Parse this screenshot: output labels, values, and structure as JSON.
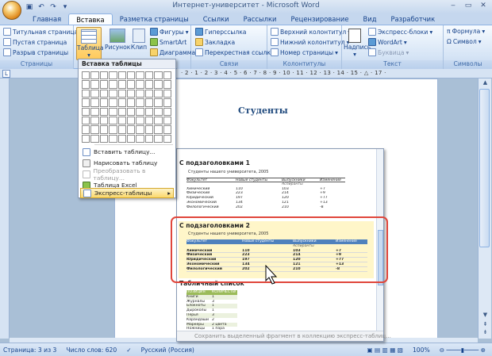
{
  "app": {
    "window_title": "Интернет-университет - Microsoft Word"
  },
  "ribbon_tabs": [
    "Главная",
    "Вставка",
    "Разметка страницы",
    "Ссылки",
    "Рассылки",
    "Рецензирование",
    "Вид",
    "Разработчик"
  ],
  "ribbon": {
    "pages": {
      "title_page": "Титульная страница",
      "blank_page": "Пустая страница",
      "page_break": "Разрыв страницы",
      "group": "Страницы"
    },
    "table_btn": "Таблица",
    "illustrations": {
      "picture": "Рисунок",
      "clip": "Клип",
      "shapes": "Фигуры",
      "smartart": "SmartArt",
      "chart": "Диаграмма"
    },
    "links": {
      "hyperlink": "Гиперссылка",
      "bookmark": "Закладка",
      "crossref": "Перекрестная ссылка",
      "group": "Связи"
    },
    "header_footer": {
      "header": "Верхний колонтитул",
      "footer": "Нижний колонтитул",
      "page_number": "Номер страницы",
      "group": "Колонтитулы"
    },
    "text": {
      "textbox": "Надпись",
      "quickparts": "Экспресс-блоки",
      "wordart": "WordArt",
      "dropcap": "Буквица",
      "group": "Текст"
    },
    "symbols": {
      "equation": "Формула",
      "symbol": "Символ",
      "group": "Символы"
    }
  },
  "document": {
    "heading": "Студенты"
  },
  "table_menu": {
    "header": "Вставка таблицы",
    "items": [
      "Вставить таблицу...",
      "Нарисовать таблицу",
      "Преобразовать в таблицу...",
      "Таблица Excel",
      "Экспресс-таблицы"
    ]
  },
  "gallery": {
    "sections": [
      "С подзаголовками 1",
      "С подзаголовками 2",
      "Табличный список"
    ],
    "footer": "Сохранить выделенный фрагмент в коллекцию экспресс-таблиц...",
    "sample_caption": "Студенты нашего университета, 2005",
    "columns": [
      "Факультет",
      "Новые студенты",
      "Выпускники",
      "Изменение"
    ],
    "subheader": "Аспиранты",
    "rows": [
      [
        "Химический",
        "110",
        "103",
        "+7"
      ],
      [
        "Физический",
        "223",
        "214",
        "+9"
      ],
      [
        "Юридический",
        "197",
        "120",
        "+77"
      ],
      [
        "Экономический",
        "134",
        "121",
        "+13"
      ],
      [
        "Филологический",
        "202",
        "210",
        "-8"
      ]
    ],
    "list_columns": [
      "ПОЗИЦИЯ",
      "КОЛИЧЕСТВО"
    ],
    "list_rows": [
      [
        "Книги",
        "1"
      ],
      [
        "Журналы",
        "3"
      ],
      [
        "Блокноты",
        "1"
      ],
      [
        "Дыроколы",
        "1"
      ],
      [
        "Перья",
        "3"
      ],
      [
        "Карандаши",
        "2"
      ],
      [
        "Маркеры",
        "2 цвета"
      ],
      [
        "Ножницы",
        "1 пара"
      ]
    ]
  },
  "status": {
    "page": "Страница: 3 из 3",
    "words": "Число слов: 620",
    "language": "Русский (Россия)",
    "zoom": "100%"
  }
}
